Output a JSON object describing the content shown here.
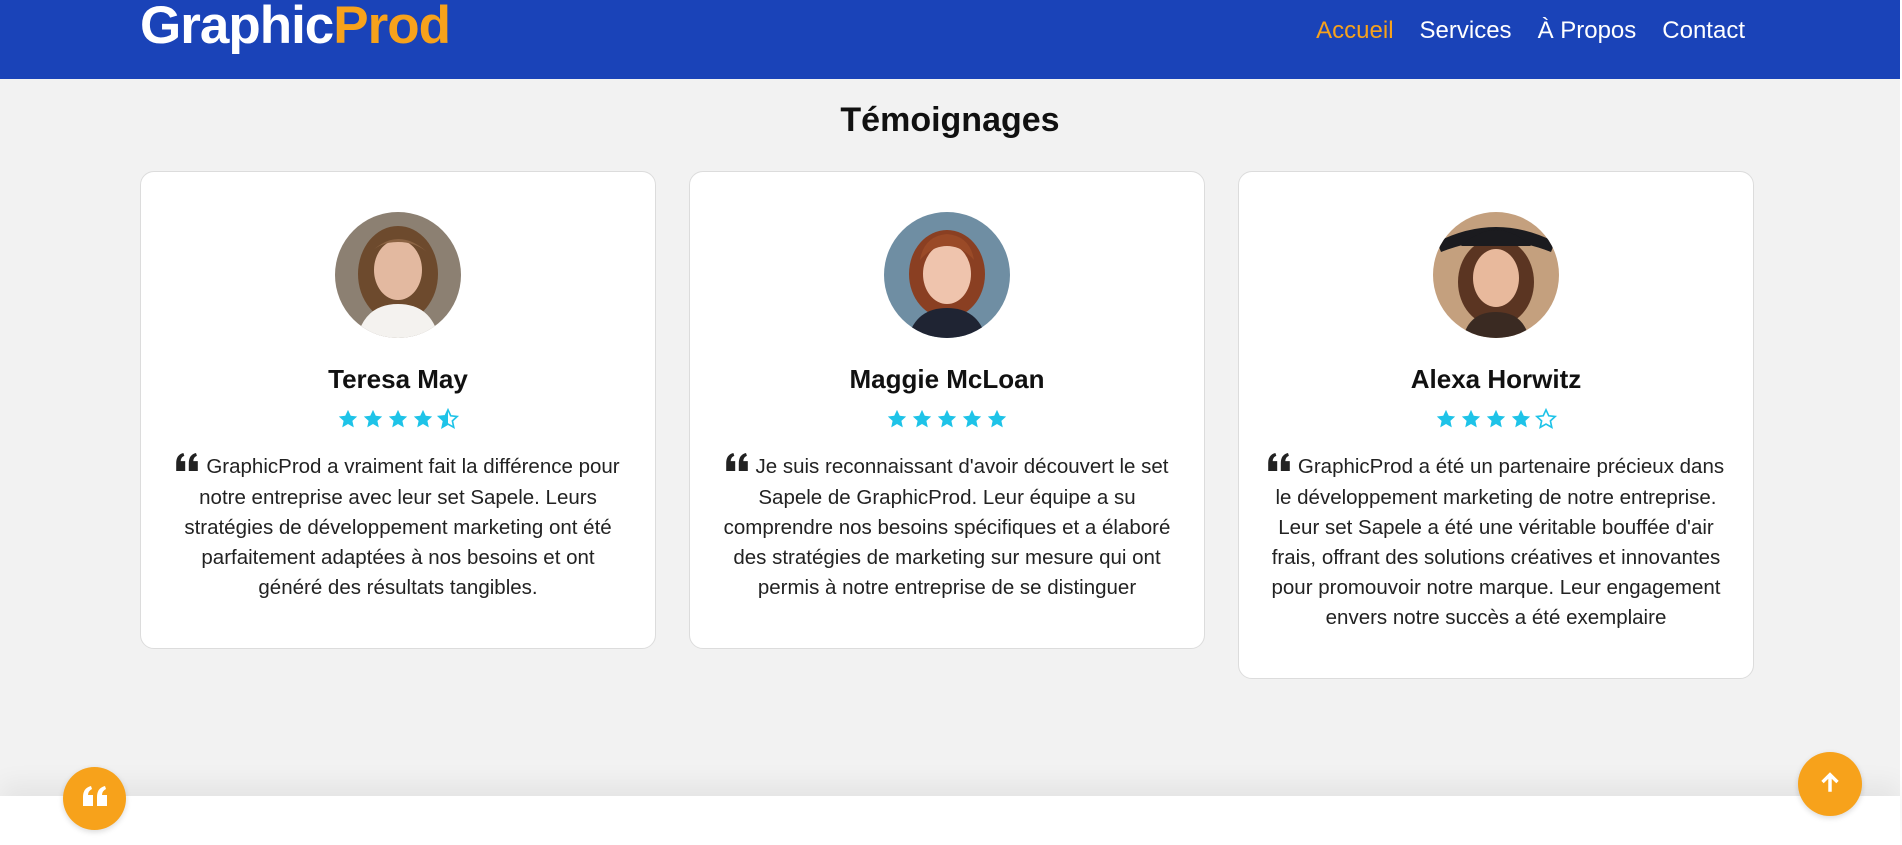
{
  "header": {
    "logo": {
      "part1": "Graphic",
      "part2": "Prod"
    },
    "nav": [
      {
        "label": "Accueil",
        "active": true
      },
      {
        "label": "Services",
        "active": false
      },
      {
        "label": "À Propos",
        "active": false
      },
      {
        "label": "Contact",
        "active": false
      }
    ]
  },
  "testimonials": {
    "title": "Témoignages",
    "items": [
      {
        "name": "Teresa May",
        "rating": 4.5,
        "quote": "GraphicProd a vraiment fait la différence pour notre entreprise avec leur set Sapele. Leurs stratégies de développement marketing ont été parfaitement adaptées à nos besoins et ont généré des résultats tangibles."
      },
      {
        "name": "Maggie McLoan",
        "rating": 5,
        "quote": "Je suis reconnaissant d'avoir découvert le set Sapele de GraphicProd. Leur équipe a su comprendre nos besoins spécifiques et a élaboré des stratégies de marketing sur mesure qui ont permis à notre entreprise de se distinguer"
      },
      {
        "name": "Alexa Horwitz",
        "rating": 4,
        "quote": "GraphicProd a été un partenaire précieux dans le développement marketing de notre entreprise. Leur set Sapele a été une véritable bouffée d'air frais, offrant des solutions créatives et innovantes pour promouvoir notre marque. Leur engagement envers notre succès a été exemplaire"
      }
    ]
  },
  "colors": {
    "header_bg": "#1a43b8",
    "accent": "#f7a21b",
    "star": "#1ec3e8"
  },
  "icons": {
    "quote": "quote-left-icon",
    "star_full": "star-icon",
    "star_half": "star-half-icon",
    "star_empty": "star-outline-icon",
    "back_to_top": "arrow-up-icon",
    "floating_quote": "quote-left-icon"
  }
}
